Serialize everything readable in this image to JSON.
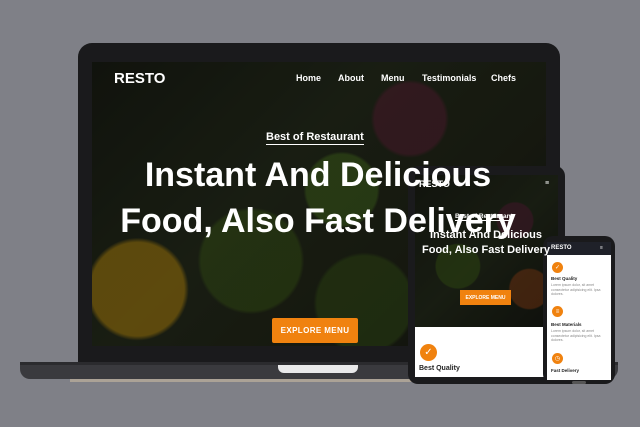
{
  "brand": "RESTO",
  "nav": [
    "Home",
    "About",
    "Menu",
    "Testimonials",
    "Chefs"
  ],
  "hero": {
    "tag": "Best of Restaurant",
    "headline_laptop": "Instant And Delicious Food, Also Fast Delivery",
    "cta": "EXPLORE MENU"
  },
  "tablet": {
    "brand": "RESTO",
    "menu_icon": "≡",
    "tag": "Best of Restaurant",
    "headline": "Instant And Delicious Food, Also Fast Delivery",
    "cta": "EXPLORE MENU",
    "feature": "Best Quality"
  },
  "phone": {
    "brand": "RESTO",
    "menu_icon": "≡",
    "features": [
      {
        "title": "Best Quality",
        "text": "Lorem ipsum dolor, sit amet consectetur adipisicing elit. Ipsa dolores."
      },
      {
        "title": "Best Materials",
        "text": "Lorem ipsum dolor, sit amet consectetur adipisicing elit. Ipsa dolores."
      },
      {
        "title": "Fast Delivery",
        "text": ""
      }
    ]
  },
  "colors": {
    "accent": "#f0820f",
    "background": "#7f8087"
  }
}
